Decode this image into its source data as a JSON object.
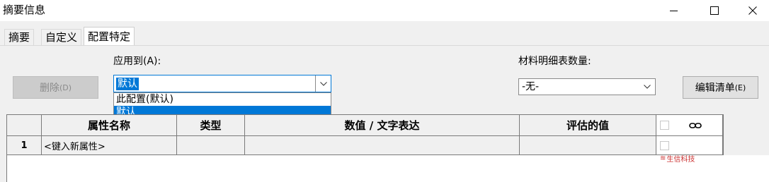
{
  "window": {
    "title": "摘要信息"
  },
  "tabs": [
    "摘要",
    "自定义",
    "配置特定"
  ],
  "apply_to": {
    "label": "应用到(A):",
    "selected": "默认",
    "options": [
      "此配置(默认)",
      "默认"
    ]
  },
  "bom_qty": {
    "label": "材料明细表数量:",
    "value": "-无-"
  },
  "buttons": {
    "delete": "删除",
    "delete_key": "(D)",
    "edit_list": "编辑清单",
    "edit_list_key": "(E)"
  },
  "grid": {
    "headers": [
      "属性名称",
      "类型",
      "数值 / 文字表达",
      "评估的值"
    ],
    "rows": [
      {
        "num": "1",
        "name": "<键入新属性>",
        "type": "",
        "value": "",
        "evaluated": ""
      }
    ]
  },
  "watermark": "生信科技",
  "colors": {
    "accent": "#0078d7",
    "panel": "#f0f0f0"
  }
}
